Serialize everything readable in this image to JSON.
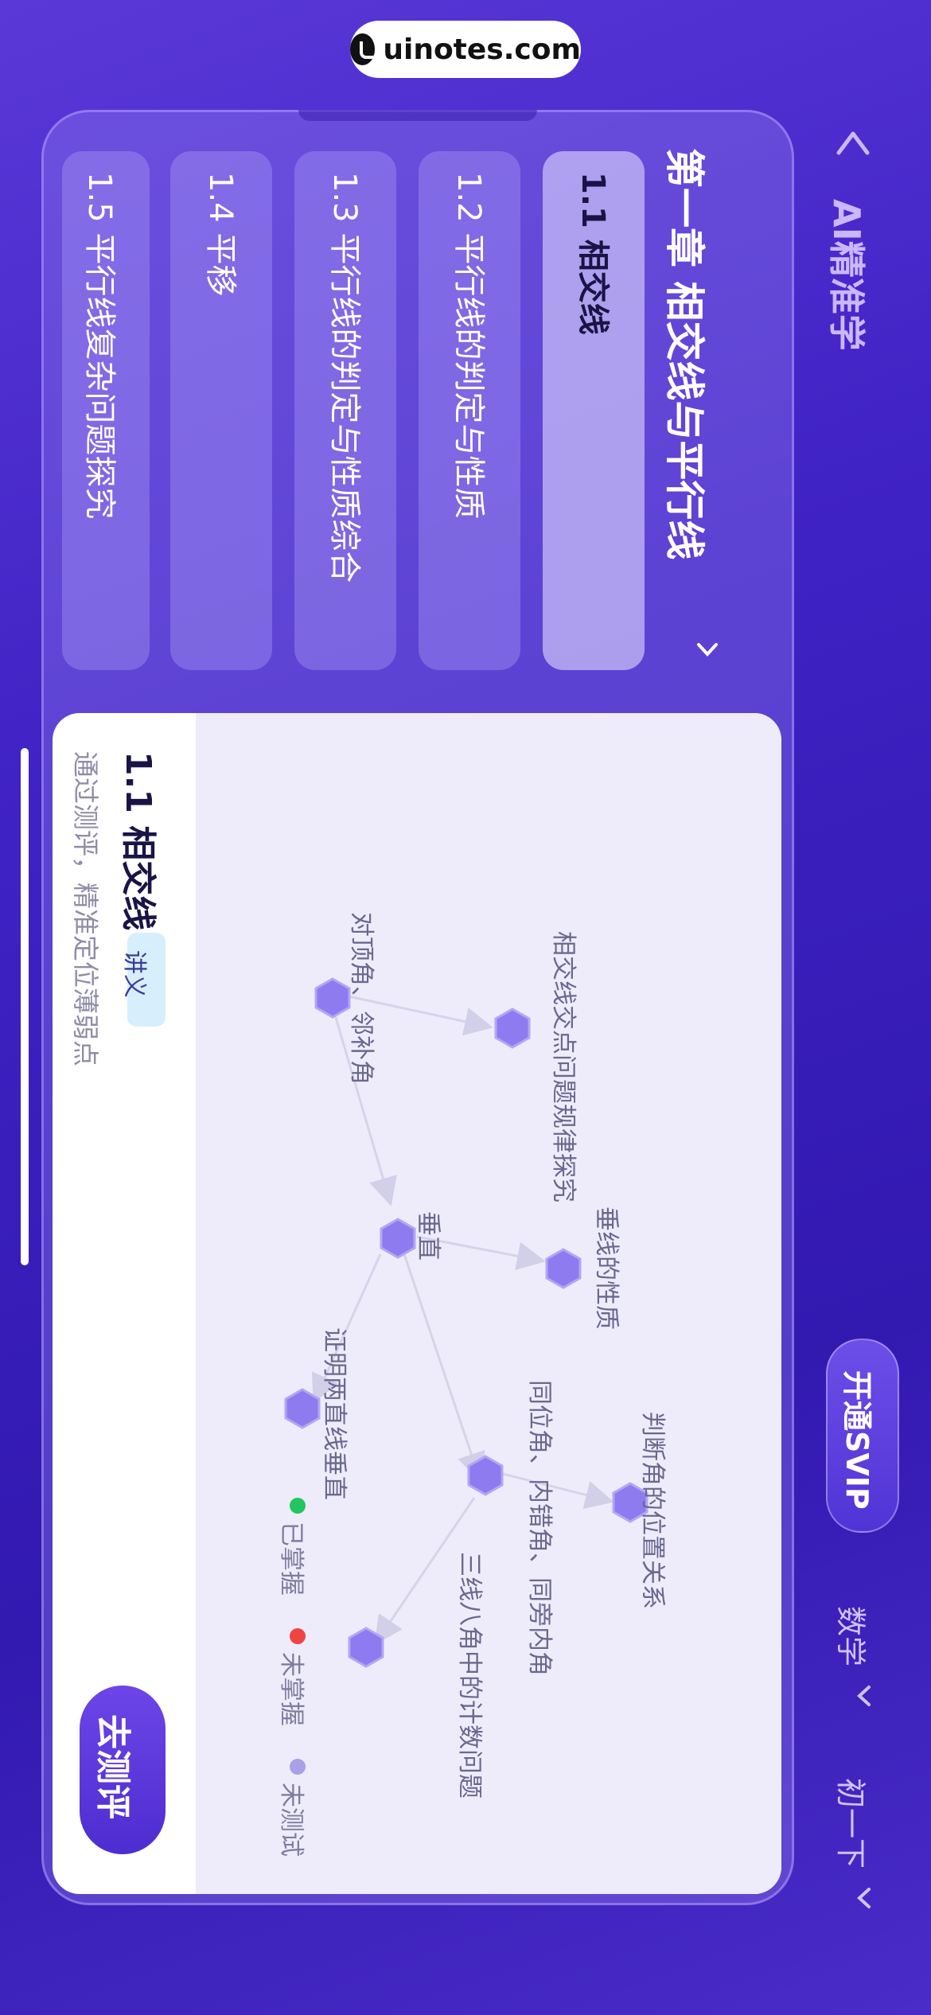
{
  "watermark": {
    "text": "uinotes.com"
  },
  "header": {
    "title": "AI精准学",
    "svip_button": "开通SVIP",
    "subject": "数学",
    "grade": "初一下"
  },
  "chapter": {
    "title": "第一章 相交线与平行线"
  },
  "sections": [
    {
      "label": "1.1 相交线",
      "active": true
    },
    {
      "label": "1.2 平行线的判定与性质",
      "active": false
    },
    {
      "label": "1.3 平行线的判定与性质综合",
      "active": false
    },
    {
      "label": "1.4 平移",
      "active": false
    },
    {
      "label": "1.5 平行线复杂问题探究",
      "active": false
    }
  ],
  "detail": {
    "title": "1.1 相交线",
    "tag": "讲义",
    "description": "通过测评，精准定位薄弱点",
    "cta": "去测评"
  },
  "knowledge_graph": {
    "nodes": [
      {
        "id": "n1",
        "label": "对顶角、邻补角"
      },
      {
        "id": "n2",
        "label": "相交线交点问题规律探究"
      },
      {
        "id": "n3",
        "label": "垂直"
      },
      {
        "id": "n4",
        "label": "垂线的性质"
      },
      {
        "id": "n5",
        "label": "证明两直线垂直"
      },
      {
        "id": "n6",
        "label": "同位角、内错角、同旁内角"
      },
      {
        "id": "n7",
        "label": "判断角的位置关系"
      },
      {
        "id": "n8",
        "label": "三线八角中的计数问题"
      }
    ],
    "edges": [
      [
        "n1",
        "n2"
      ],
      [
        "n1",
        "n3"
      ],
      [
        "n3",
        "n4"
      ],
      [
        "n3",
        "n5"
      ],
      [
        "n3",
        "n6"
      ],
      [
        "n6",
        "n7"
      ],
      [
        "n6",
        "n8"
      ]
    ]
  },
  "legend": [
    {
      "label": "已掌握",
      "color": "#22c55e"
    },
    {
      "label": "未掌握",
      "color": "#ef4444"
    },
    {
      "label": "未测试",
      "color": "#a8a0e8"
    }
  ],
  "colors": {
    "accent": "#5b3ae0",
    "node": "#8f7bf0"
  }
}
